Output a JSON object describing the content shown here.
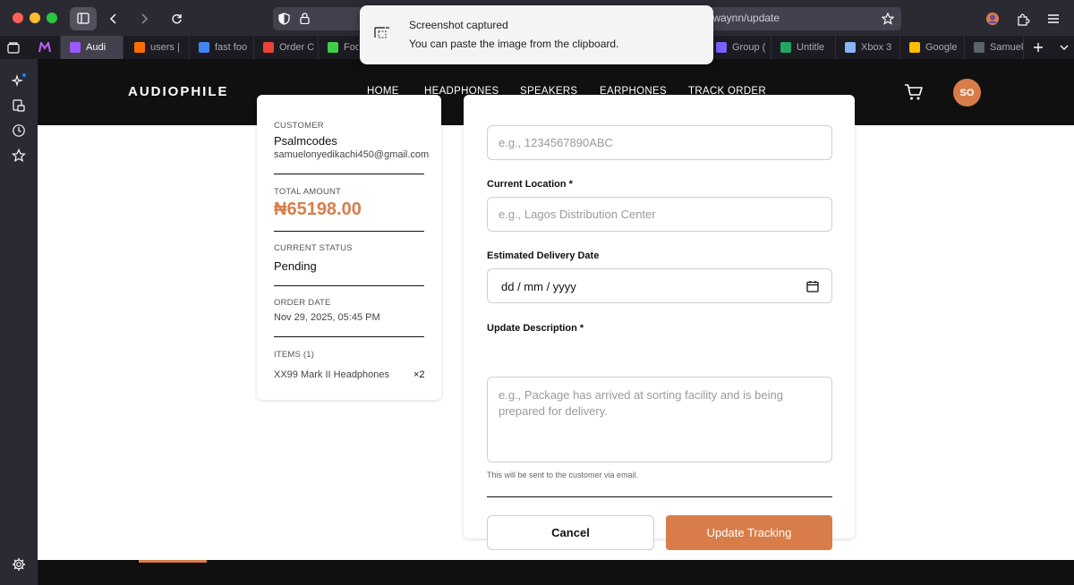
{
  "browser": {
    "url_visible": "/waynn/update",
    "tabs": [
      {
        "label": "Audi",
        "color": "#9b59ff",
        "active": true
      },
      {
        "label": "users |",
        "color": "#ff6d00"
      },
      {
        "label": "fast foo",
        "color": "#4285f4"
      },
      {
        "label": "Order C",
        "color": "#ea4335"
      },
      {
        "label": "Food",
        "color": "#3ecf4a"
      },
      {
        "label": "Group (",
        "color": "#7b61ff"
      },
      {
        "label": "Untitle",
        "color": "#23a566"
      },
      {
        "label": "Xbox 3",
        "color": "#8ab4f8"
      },
      {
        "label": "Google",
        "color": "#fbbc04"
      },
      {
        "label": "Samuel",
        "color": "#5f6368"
      }
    ]
  },
  "notification": {
    "title": "Screenshot captured",
    "body": "You can paste the image from the clipboard."
  },
  "site": {
    "logo": "AUDIOPHILE",
    "nav": [
      "HOME",
      "HEADPHONES",
      "SPEAKERS",
      "EARPHONES",
      "TRACK ORDER"
    ],
    "avatar_initials": "SO",
    "accent_color": "#d87d4a"
  },
  "order_summary": {
    "customer_label": "CUSTOMER",
    "customer_name": "Psalmcodes",
    "customer_email": "samuelonyedikachi450@gmail.com",
    "total_label": "TOTAL AMOUNT",
    "total_amount": "₦65198.00",
    "status_label": "CURRENT STATUS",
    "status": "Pending",
    "date_label": "ORDER DATE",
    "date": "Nov 29, 2025, 05:45 PM",
    "items_label": "ITEMS (1)",
    "items": [
      {
        "name": "XX99 Mark II Headphones",
        "qty": "×2"
      }
    ]
  },
  "form": {
    "tracking_placeholder": "e.g., 1234567890ABC",
    "location_label": "Current Location *",
    "location_placeholder": "e.g., Lagos Distribution Center",
    "delivery_label": "Estimated Delivery Date",
    "delivery_value": "dd / mm / yyyy",
    "description_label": "Update Description *",
    "description_placeholder": "e.g., Package has arrived at sorting facility and is being prepared for delivery.",
    "hint": "This will be sent to the customer via email.",
    "cancel_label": "Cancel",
    "submit_label": "Update Tracking"
  }
}
